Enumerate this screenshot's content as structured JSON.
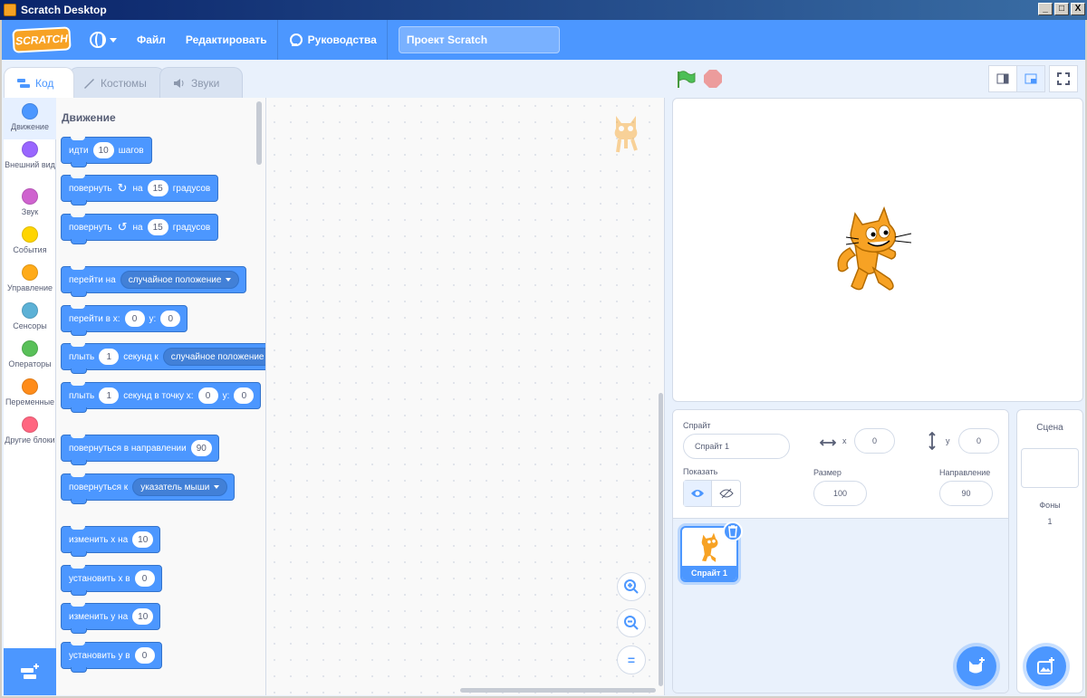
{
  "window": {
    "title": "Scratch Desktop",
    "buttons": [
      "_",
      "□",
      "X"
    ]
  },
  "menubar": {
    "logo": "SCRATCH",
    "file": "Файл",
    "edit": "Редактировать",
    "tutorials": "Руководства",
    "project_title": "Проект Scratch"
  },
  "tabs": [
    {
      "label": "Код",
      "icon": "code-icon"
    },
    {
      "label": "Костюмы",
      "icon": "brush-icon"
    },
    {
      "label": "Звуки",
      "icon": "speaker-icon"
    }
  ],
  "categories": [
    {
      "label": "Движение",
      "color": "#4c97ff"
    },
    {
      "label": "Внешний вид",
      "color": "#9966ff"
    },
    {
      "label": "Звук",
      "color": "#cf63cf"
    },
    {
      "label": "События",
      "color": "#ffd500"
    },
    {
      "label": "Управление",
      "color": "#ffab19"
    },
    {
      "label": "Сенсоры",
      "color": "#5cb1d6"
    },
    {
      "label": "Операторы",
      "color": "#59c059"
    },
    {
      "label": "Переменные",
      "color": "#ff8c1a"
    },
    {
      "label": "Другие блоки",
      "color": "#ff6680"
    }
  ],
  "palette": {
    "heading": "Движение",
    "blocks": {
      "move": {
        "a": "идти",
        "v": "10",
        "b": "шагов"
      },
      "turn_right": {
        "a": "повернуть",
        "b": "на",
        "v": "15",
        "c": "градусов"
      },
      "turn_left": {
        "a": "повернуть",
        "b": "на",
        "v": "15",
        "c": "градусов"
      },
      "goto": {
        "a": "перейти на",
        "d": "случайное положение"
      },
      "goto_xy": {
        "a": "перейти в x:",
        "x": "0",
        "b": "y:",
        "y": "0"
      },
      "glide": {
        "a": "плыть",
        "v": "1",
        "b": "секунд к",
        "d": "случайное положение"
      },
      "glide_xy": {
        "a": "плыть",
        "v": "1",
        "b": "секунд в точку x:",
        "x": "0",
        "c": "y:",
        "y": "0"
      },
      "point_dir": {
        "a": "повернуться в направлении",
        "v": "90"
      },
      "point_towards": {
        "a": "повернуться к",
        "d": "указатель мыши"
      },
      "change_x": {
        "a": "изменить x на",
        "v": "10"
      },
      "set_x": {
        "a": "установить x в",
        "v": "0"
      },
      "change_y": {
        "a": "изменить y на",
        "v": "10"
      },
      "set_y": {
        "a": "установить y в",
        "v": "0"
      }
    }
  },
  "sprite_info": {
    "sprite_label": "Спрайт",
    "sprite_name": "Спрайт 1",
    "x_label": "x",
    "x_value": "0",
    "y_label": "y",
    "y_value": "0",
    "show_label": "Показать",
    "size_label": "Размер",
    "size_value": "100",
    "direction_label": "Направление",
    "direction_value": "90"
  },
  "sprites": [
    {
      "name": "Спрайт 1"
    }
  ],
  "stage_pane": {
    "title": "Сцена",
    "backdrops_label": "Фоны",
    "backdrops_count": "1"
  },
  "zoom": {
    "reset": "="
  }
}
